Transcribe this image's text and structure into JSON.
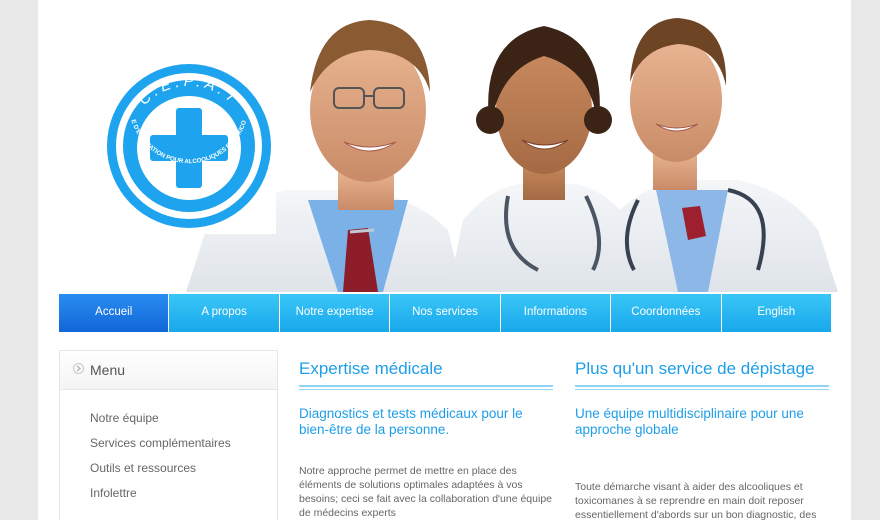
{
  "logo": {
    "letters": "C.É.P.A.T",
    "ring_text": "CENTRE D'ÉVALUATION POUR ALCOOLIQUES ET TOXICOMANES"
  },
  "nav": {
    "items": [
      {
        "label": "Accueil",
        "active": true
      },
      {
        "label": "A propos",
        "active": false
      },
      {
        "label": "Notre expertise",
        "active": false
      },
      {
        "label": "Nos services",
        "active": false
      },
      {
        "label": "Informations",
        "active": false
      },
      {
        "label": "Coordonnées",
        "active": false
      },
      {
        "label": "English",
        "active": false
      }
    ]
  },
  "sidebar": {
    "title": "Menu",
    "items": [
      {
        "label": "Notre équipe"
      },
      {
        "label": "Services complémentaires"
      },
      {
        "label": "Outils et ressources"
      },
      {
        "label": "Infolettre"
      }
    ]
  },
  "columns": [
    {
      "heading": "Expertise médicale",
      "subheading": "Diagnostics et tests médicaux pour le bien-être de la personne.",
      "body": "Notre approche permet de mettre en place des éléments de solutions optimales adaptées à vos besoins; ceci se fait avec la collaboration d'une équipe de médecins experts"
    },
    {
      "heading": "Plus qu'un service de dépistage",
      "subheading": "Une équipe multidisciplinaire pour une approche globale",
      "body": "Toute démarche visant à aider des alcooliques et toxicomanes à se reprendre en main doit reposer essentiellement d'abords sur un bon diagnostic, des"
    }
  ],
  "colors": {
    "accent": "#1e9ee8",
    "nav": "#18a8ec",
    "nav_active": "#1167d8",
    "logo_blue": "#1ea3ef"
  }
}
